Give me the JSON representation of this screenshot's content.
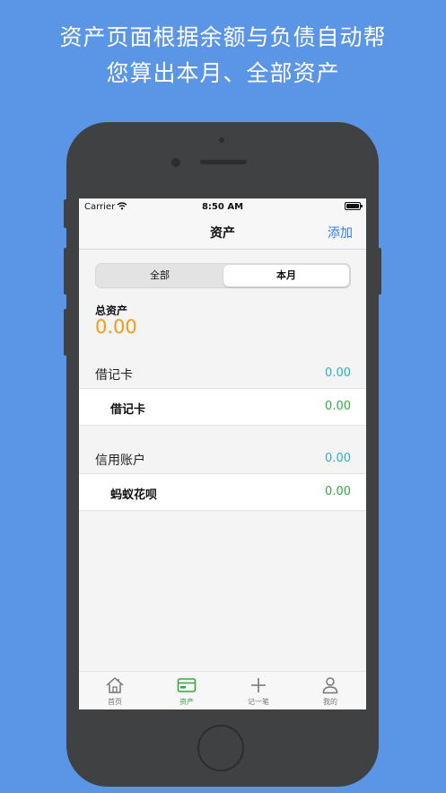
{
  "promo": {
    "line1": "资产页面根据余额与负债自动帮",
    "line2": "您算出本月、全部资产"
  },
  "status": {
    "carrier": "Carrier",
    "time": "8:50 AM"
  },
  "nav": {
    "title": "资产",
    "add_label": "添加"
  },
  "segment": {
    "options": [
      "全部",
      "本月"
    ],
    "selected": "本月"
  },
  "total": {
    "label": "总资产",
    "value": "0.00"
  },
  "sections": [
    {
      "title": "借记卡",
      "amount": "0.00",
      "items": [
        {
          "name": "借记卡",
          "amount": "0.00"
        }
      ]
    },
    {
      "title": "信用账户",
      "amount": "0.00",
      "items": [
        {
          "name": "蚂蚁花呗",
          "amount": "0.00"
        }
      ]
    }
  ],
  "tabs": [
    {
      "label": "首页",
      "icon": "home-icon"
    },
    {
      "label": "资产",
      "icon": "card-icon",
      "active": true
    },
    {
      "label": "记一笔",
      "icon": "plus-icon"
    },
    {
      "label": "我的",
      "icon": "person-icon"
    }
  ],
  "colors": {
    "background": "#5b95e6",
    "accent_blue": "#2f7cf6",
    "total_orange": "#f49a16",
    "section_teal": "#2bb3c4",
    "item_green": "#35a845"
  }
}
